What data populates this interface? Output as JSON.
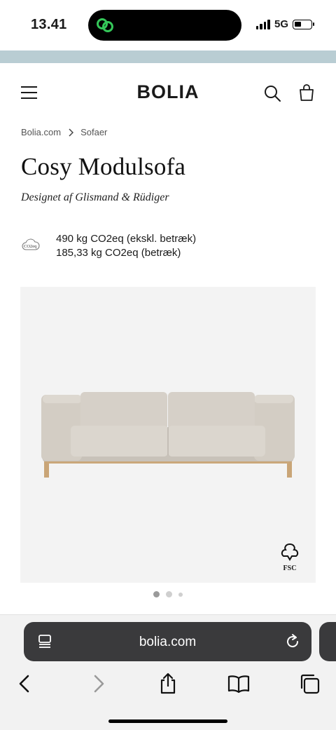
{
  "status_bar": {
    "time": "13.41",
    "network": "5G"
  },
  "header": {
    "logo": "BOLIA"
  },
  "breadcrumb": {
    "items": [
      "Bolia.com",
      "Sofaer"
    ]
  },
  "product": {
    "title": "Cosy Modulsofa",
    "designer": "Designet af Glismand & Rüdiger",
    "co2_ex_cover": "490 kg CO2eq (ekskl. betræk)",
    "co2_cover": "185,33 kg CO2eq (betræk)",
    "co2_badge": "CO2eq",
    "fsc_label": "FSC"
  },
  "gallery": {
    "active_index": 0,
    "slide_count": 3
  },
  "browser": {
    "url": "bolia.com"
  },
  "colors": {
    "announce_bar": "#b9cdd3",
    "url_pill": "#3a3a3c",
    "island_icon": "#34c759"
  }
}
